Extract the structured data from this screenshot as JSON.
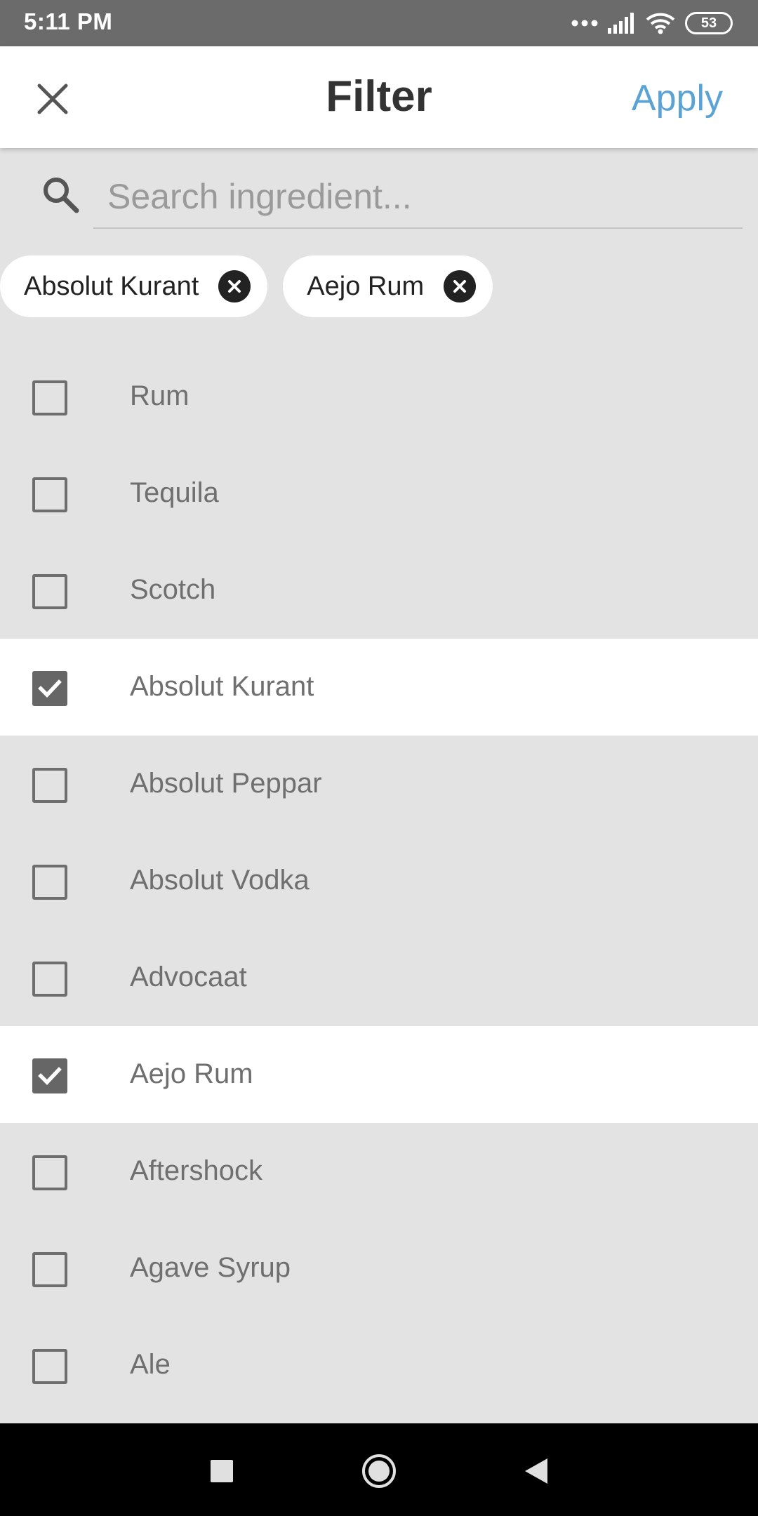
{
  "status_bar": {
    "time": "5:11 PM",
    "battery": "53"
  },
  "app_bar": {
    "title": "Filter",
    "apply_label": "Apply"
  },
  "search": {
    "placeholder": "Search ingredient...",
    "value": ""
  },
  "chips": [
    {
      "label": "Absolut Kurant"
    },
    {
      "label": "Aejo Rum"
    }
  ],
  "ingredients": [
    {
      "label": "Rum",
      "checked": false
    },
    {
      "label": "Tequila",
      "checked": false
    },
    {
      "label": "Scotch",
      "checked": false
    },
    {
      "label": "Absolut Kurant",
      "checked": true
    },
    {
      "label": "Absolut Peppar",
      "checked": false
    },
    {
      "label": "Absolut Vodka",
      "checked": false
    },
    {
      "label": "Advocaat",
      "checked": false
    },
    {
      "label": "Aejo Rum",
      "checked": true
    },
    {
      "label": "Aftershock",
      "checked": false
    },
    {
      "label": "Agave Syrup",
      "checked": false
    },
    {
      "label": "Ale",
      "checked": false
    }
  ],
  "colors": {
    "accent": "#5aa3d4",
    "selected_row": "#ffffff",
    "background": "#e3e3e3"
  }
}
